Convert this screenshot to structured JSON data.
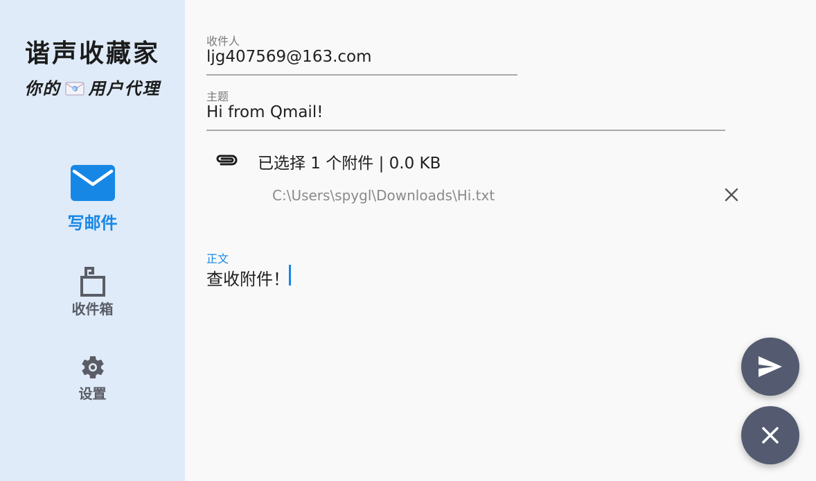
{
  "brand": {
    "title": "谐声收藏家",
    "subtitle_prefix": "你的",
    "subtitle_suffix": "用户代理"
  },
  "nav": {
    "items": [
      {
        "label": "写邮件",
        "icon": "envelope-icon",
        "active": true
      },
      {
        "label": "收件箱",
        "icon": "mailbox-icon",
        "active": false
      },
      {
        "label": "设置",
        "icon": "gear-icon",
        "active": false
      }
    ]
  },
  "compose": {
    "to_label": "收件人",
    "to_value": "ljg407569@163.com",
    "subject_label": "主题",
    "subject_value": "Hi from Qmail!",
    "attachment_summary": "已选择 1 个附件 | 0.0 KB",
    "attachments": [
      {
        "path": "C:\\Users\\spygl\\Downloads\\Hi.txt"
      }
    ],
    "body_label": "正文",
    "body_value": "查收附件！"
  },
  "actions": {
    "send_icon": "send-icon",
    "discard_icon": "close-icon"
  },
  "colors": {
    "sidebar_bg": "#dfebf8",
    "accent": "#1787e6",
    "fab": "#545b70",
    "content_bg": "#f9f9f9"
  }
}
